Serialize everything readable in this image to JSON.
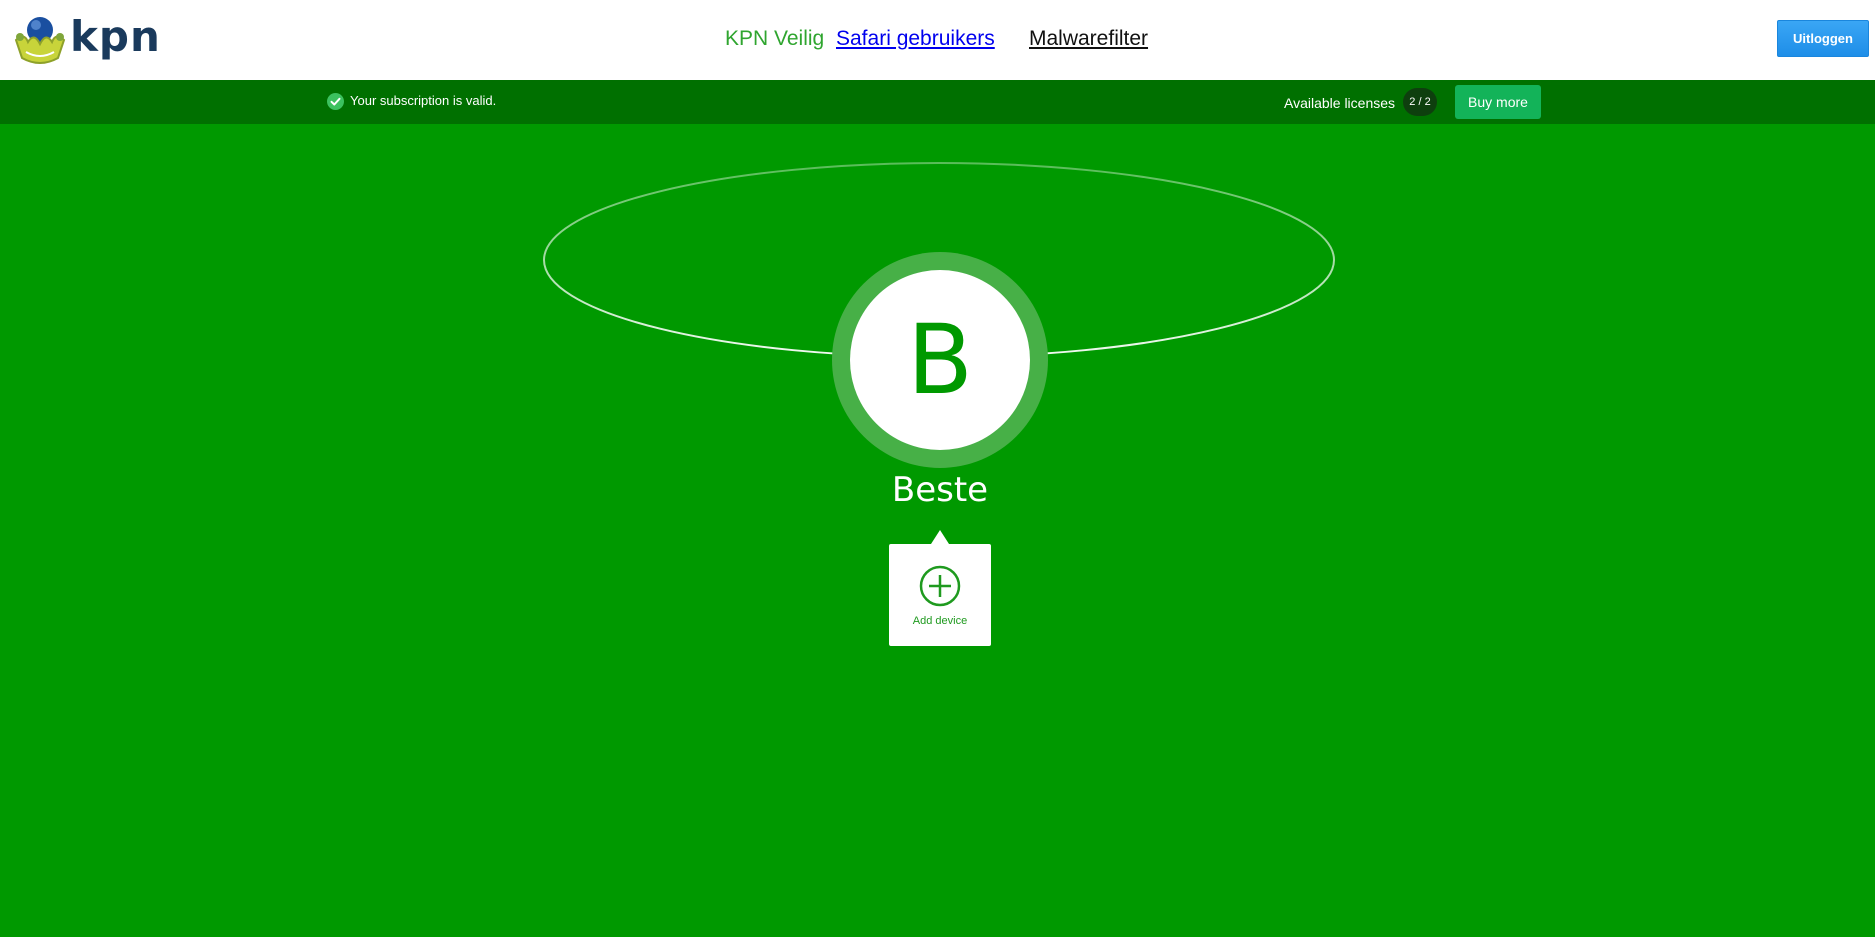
{
  "header": {
    "logo_text": "kpn",
    "nav": {
      "brand": "KPN Veilig",
      "link_safari": "Safari gebruikers",
      "link_malware": "Malwarefilter"
    },
    "logout_label": "Uitloggen"
  },
  "statusbar": {
    "subscription_text": "Your subscription is valid.",
    "licenses_label": "Available licenses",
    "licenses_count": "2 / 2",
    "buy_more_label": "Buy more"
  },
  "profile": {
    "initial": "B",
    "name": "Beste"
  },
  "device": {
    "add_label": "Add device"
  },
  "colors": {
    "background": "#009900",
    "statusbar": "#007000",
    "buy_button": "#13b359",
    "logout_button": "#1e8ee8"
  }
}
